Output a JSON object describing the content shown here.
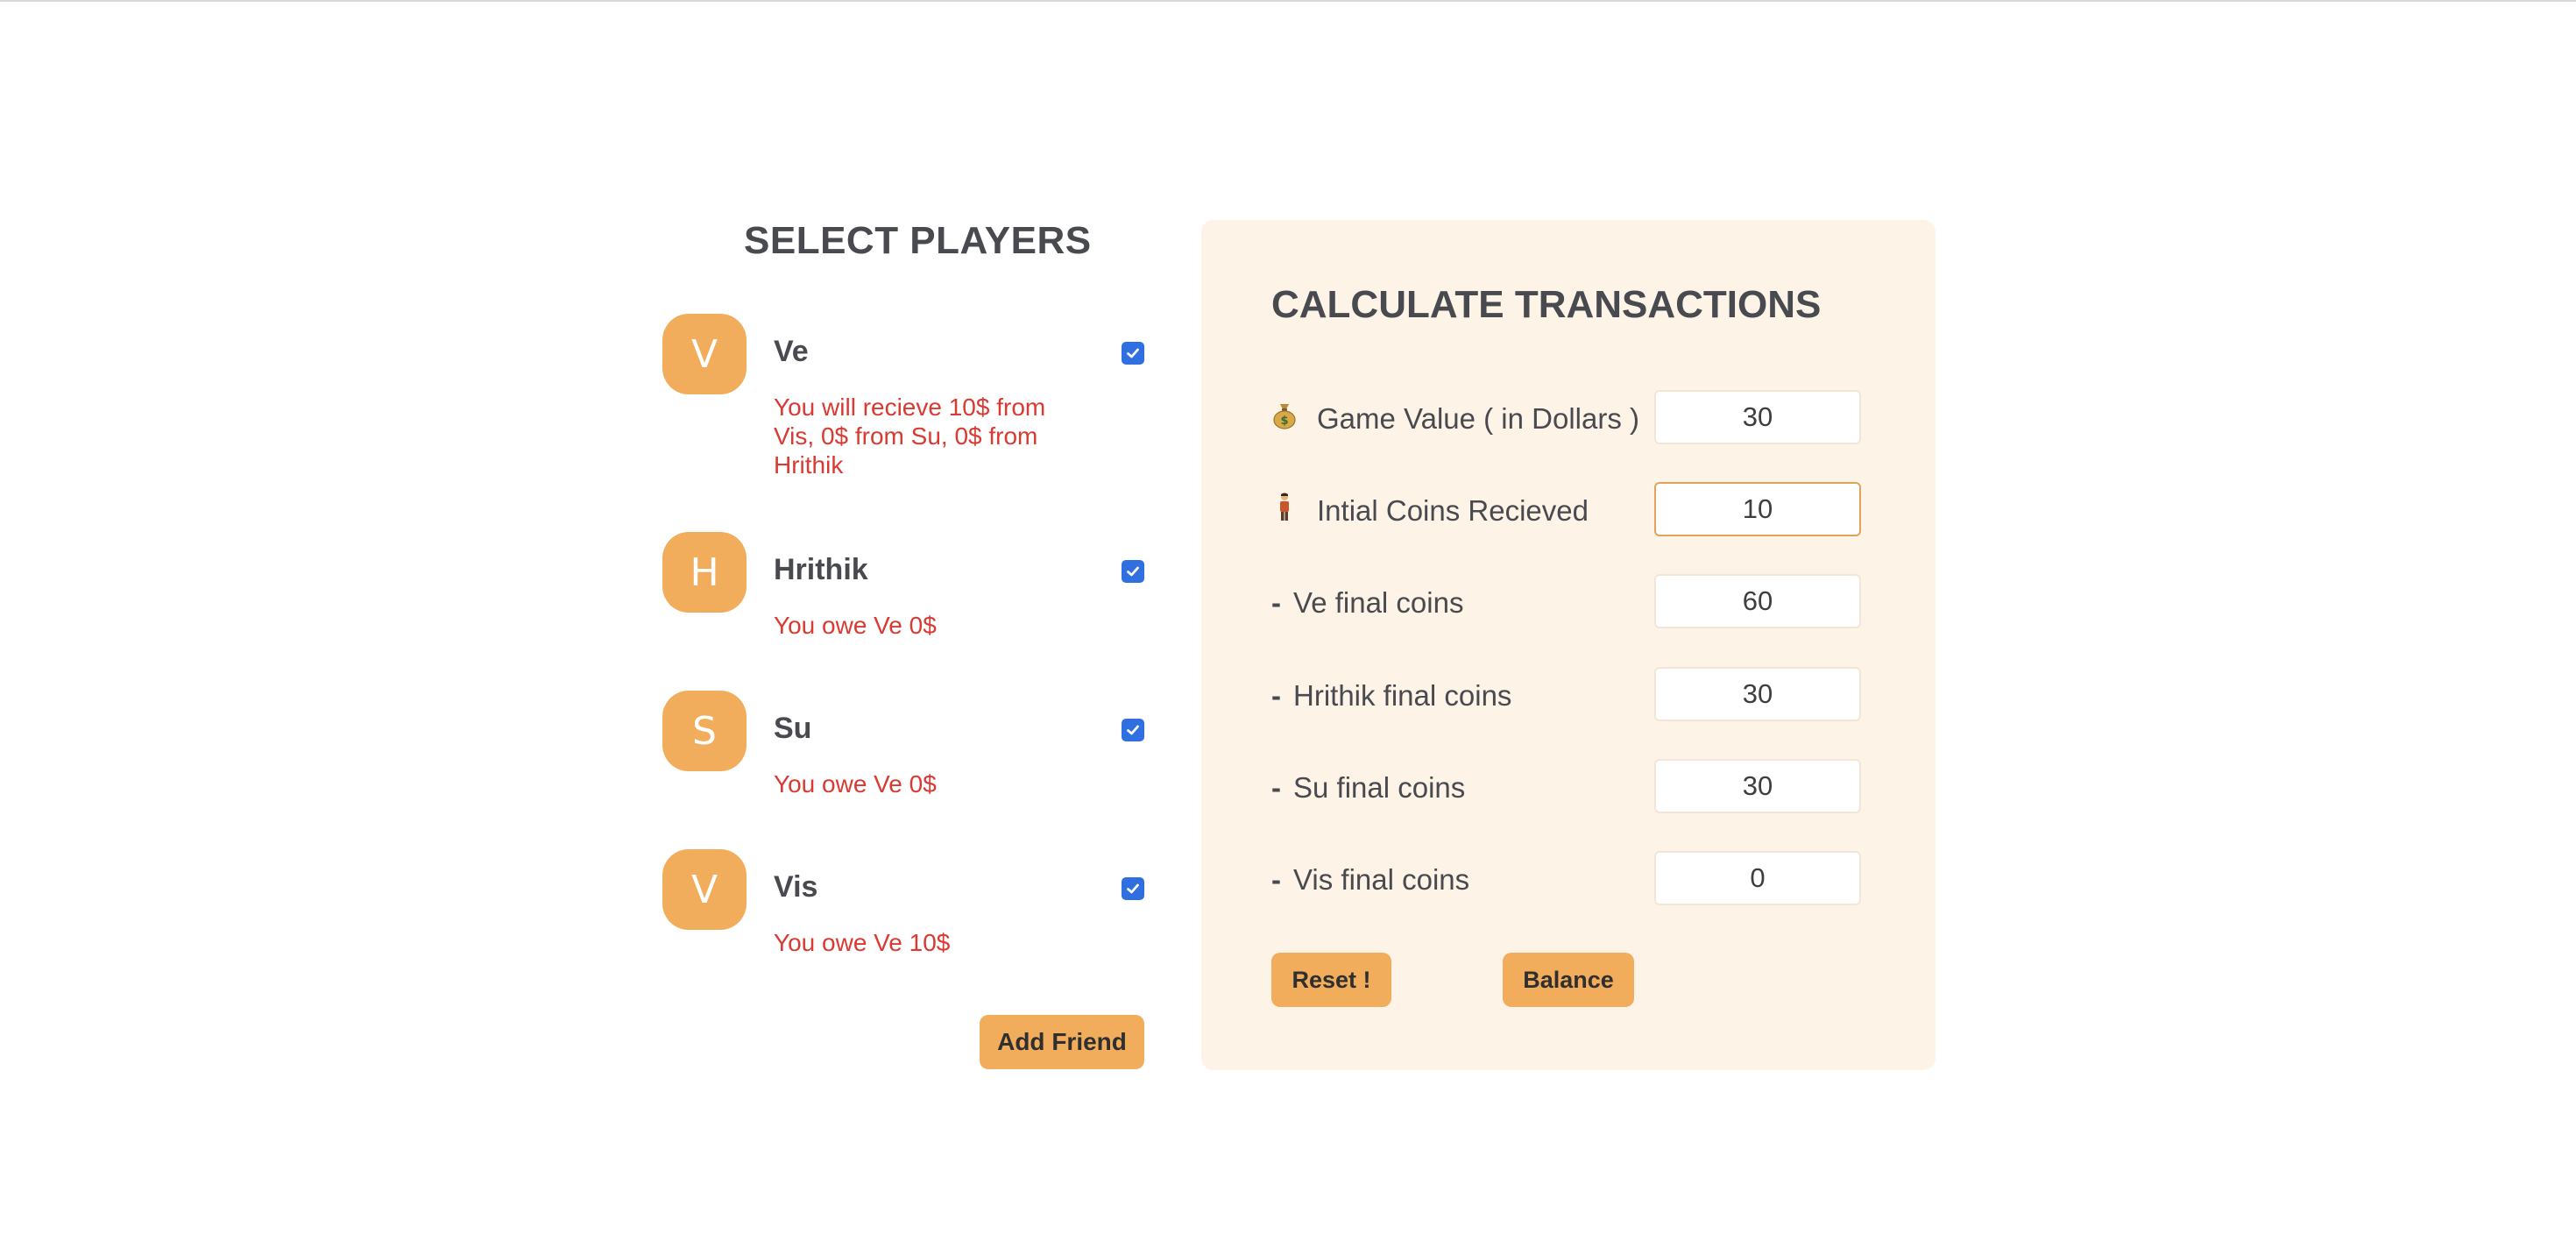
{
  "players_panel": {
    "title": "SELECT PLAYERS",
    "players": [
      {
        "initial": "V",
        "name": "Ve",
        "checked": true,
        "message": "You will recieve 10$ from Vis, 0$ from Su, 0$ from Hrithik"
      },
      {
        "initial": "H",
        "name": "Hrithik",
        "checked": true,
        "message": "You owe Ve 0$"
      },
      {
        "initial": "S",
        "name": "Su",
        "checked": true,
        "message": "You owe Ve 0$"
      },
      {
        "initial": "V",
        "name": "Vis",
        "checked": true,
        "message": "You owe Ve 10$"
      }
    ],
    "add_friend_label": "Add Friend"
  },
  "calc_panel": {
    "title": "CALCULATE TRANSACTIONS",
    "rows": [
      {
        "icon": "money-bag-icon",
        "label": "Game Value ( in Dollars )",
        "value": "30"
      },
      {
        "icon": "person-icon",
        "label": "Intial Coins Recieved",
        "value": "10"
      },
      {
        "icon": "dash",
        "label": "Ve final coins",
        "value": "60"
      },
      {
        "icon": "dash",
        "label": "Hrithik final coins",
        "value": "30"
      },
      {
        "icon": "dash",
        "label": "Su final coins",
        "value": "30"
      },
      {
        "icon": "dash",
        "label": "Vis final coins",
        "value": "0"
      }
    ],
    "dash": "-",
    "reset_label": "Reset !",
    "balance_label": "Balance"
  },
  "colors": {
    "accent": "#f2ad5c",
    "panel_bg": "#fdf3e7",
    "message_red": "#d93a32",
    "checkbox_blue": "#2f6fe0",
    "heading": "#484a4f"
  }
}
